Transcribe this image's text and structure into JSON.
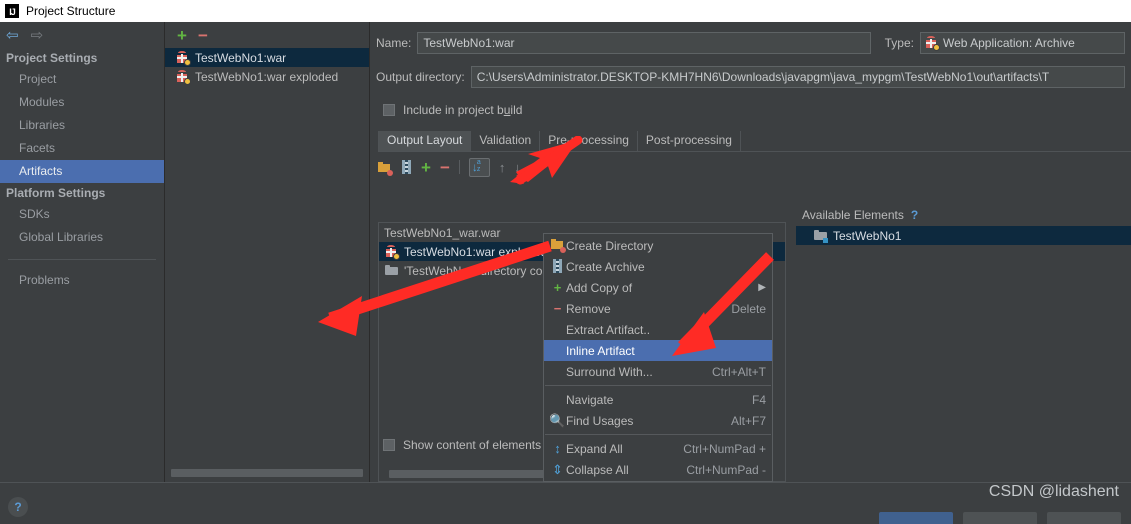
{
  "window": {
    "title": "Project Structure",
    "logo_text": "IJ"
  },
  "sidebar": {
    "nav": {
      "back_icon": "⇦",
      "forward_icon": "⇨"
    },
    "groups": [
      {
        "label": "Project Settings",
        "items": [
          {
            "label": "Project",
            "selected": false
          },
          {
            "label": "Modules",
            "selected": false
          },
          {
            "label": "Libraries",
            "selected": false
          },
          {
            "label": "Facets",
            "selected": false
          },
          {
            "label": "Artifacts",
            "selected": true
          }
        ]
      },
      {
        "label": "Platform Settings",
        "items": [
          {
            "label": "SDKs",
            "selected": false
          },
          {
            "label": "Global Libraries",
            "selected": false
          }
        ]
      }
    ],
    "problems_label": "Problems"
  },
  "artifacts_panel": {
    "toolbar": {
      "add_label": "+",
      "remove_label": "−"
    },
    "items": [
      {
        "label": "TestWebNo1:war",
        "selected": true
      },
      {
        "label": "TestWebNo1:war exploded",
        "selected": false
      }
    ]
  },
  "details": {
    "name_label": "Name:",
    "name_value": "TestWebNo1:war",
    "type_label": "Type:",
    "type_value": "Web Application: Archive",
    "output_dir_label": "Output directory:",
    "output_dir_value": "C:\\Users\\Administrator.DESKTOP-KMH7HN6\\Downloads\\javapgm\\java_mypgm\\TestWebNo1\\out\\artifacts\\T",
    "include_in_build_label": "Include in project build",
    "include_in_build_checked": false,
    "tabs": [
      {
        "label": "Output Layout",
        "active": true
      },
      {
        "label": "Validation",
        "active": false
      },
      {
        "label": "Pre-processing",
        "active": false
      },
      {
        "label": "Post-processing",
        "active": false
      }
    ],
    "layout_toolbar": {
      "create_directory_title": "Create Directory",
      "create_archive_title": "Create Archive",
      "add_label": "+",
      "remove_label": "−",
      "sort_label": "a\nz",
      "move_up_icon": "↑",
      "move_down_icon": "↓"
    },
    "tree": [
      {
        "label": "TestWebNo1_war.war",
        "icon": "none",
        "selected": false,
        "level": 0
      },
      {
        "label": "TestWebNo1:war exploded",
        "icon": "artifact",
        "selected": true,
        "level": 1
      },
      {
        "label": "'TestWebNo1' directory co",
        "icon": "folder",
        "selected": false,
        "level": 1
      }
    ],
    "available_elements": {
      "title": "Available Elements",
      "help_icon": "?",
      "items": [
        {
          "label": "TestWebNo1",
          "selected": true
        }
      ]
    },
    "show_content_label": "Show content of elements",
    "show_content_checked": false,
    "ellipsis_label": "⋯"
  },
  "context_menu": {
    "items": [
      {
        "label": "Create Directory",
        "accel": "",
        "icon": "new-directory-icon",
        "selected": false,
        "submenu": false
      },
      {
        "label": "Create Archive",
        "accel": "",
        "icon": "archive-icon",
        "selected": false,
        "submenu": false
      },
      {
        "label": "Add Copy of",
        "accel": "",
        "icon": "plus-icon",
        "selected": false,
        "submenu": true
      },
      {
        "label": "Remove",
        "accel": "Delete",
        "icon": "minus-icon",
        "selected": false,
        "submenu": false
      },
      {
        "label": "Extract Artifact..",
        "accel": "",
        "icon": "none",
        "selected": false,
        "submenu": false
      },
      {
        "label": "Inline Artifact",
        "accel": "",
        "icon": "none",
        "selected": true,
        "submenu": false
      },
      {
        "label": "Surround With...",
        "accel": "Ctrl+Alt+T",
        "icon": "none",
        "selected": false,
        "submenu": false
      },
      {
        "label": "Navigate",
        "accel": "F4",
        "icon": "none",
        "selected": false,
        "submenu": false
      },
      {
        "label": "Find Usages",
        "accel": "Alt+F7",
        "icon": "search-icon",
        "selected": false,
        "submenu": false
      },
      {
        "label": "Expand All",
        "accel": "Ctrl+NumPad +",
        "icon": "expand-icon",
        "selected": false,
        "submenu": false
      },
      {
        "label": "Collapse All",
        "accel": "Ctrl+NumPad -",
        "icon": "collapse-icon",
        "selected": false,
        "submenu": false
      }
    ],
    "separator_after_indexes": [
      5,
      6,
      8
    ]
  },
  "footer": {
    "help_label": "?",
    "watermark": "CSDN @lidashent"
  },
  "colors": {
    "background": "#3c3f41",
    "selection_blue": "#4b6eaf",
    "tree_selection": "#0d293e",
    "accent_green": "#62b543",
    "accent_red": "#d9736f",
    "annotation_arrow": "#ff2b25"
  }
}
